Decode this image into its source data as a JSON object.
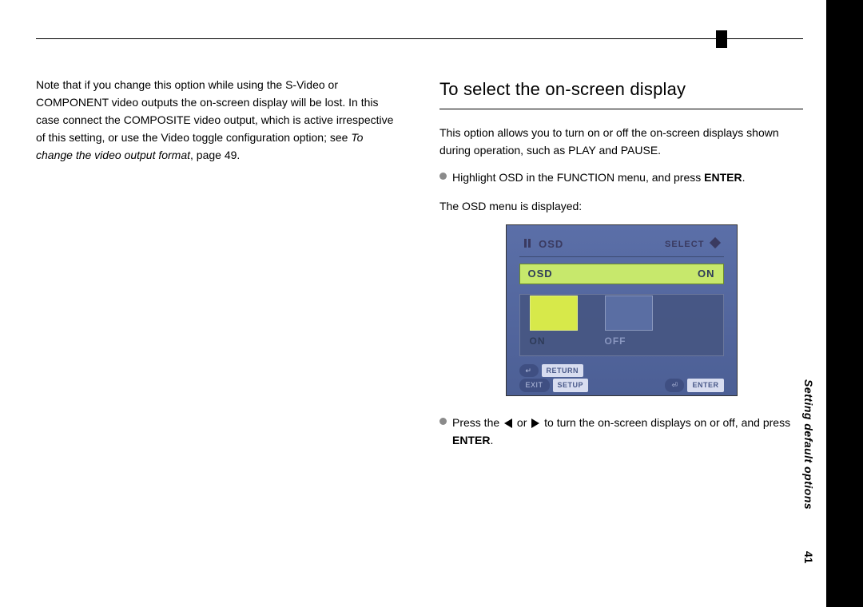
{
  "sidebar": {
    "section_label": "Setting default options",
    "page_number": "41"
  },
  "left_column": {
    "note_part1": "Note that if you change this option while using the S-Video or COMPONENT video outputs the on-screen display will be lost. In this case connect the COMPOSITE video output, which is active irrespective of this setting, or use the Video toggle configuration option; see ",
    "note_italic": "To change the video output format",
    "note_after": ", page 49."
  },
  "right_column": {
    "heading": "To select the on-screen display",
    "intro": "This option allows you to turn on or off the on-screen displays shown during operation, such as PLAY and PAUSE.",
    "bullet1_pre": "Highlight OSD in the FUNCTION menu, and press ",
    "bullet1_bold": "ENTER",
    "bullet1_post": ".",
    "osd_displayed": "The OSD menu is displayed:",
    "bullet2_pre": "Press the ",
    "bullet2_mid": " or ",
    "bullet2_post": " to turn the on-screen displays on or off, and press ",
    "bullet2_bold": "ENTER",
    "bullet2_end": "."
  },
  "osd": {
    "title": "OSD",
    "select_hint": "SELECT",
    "row_label": "OSD",
    "row_value": "ON",
    "option_on": "ON",
    "option_off": "OFF",
    "footer_return": "RETURN",
    "footer_setup": "SETUP",
    "footer_enter": "ENTER"
  }
}
